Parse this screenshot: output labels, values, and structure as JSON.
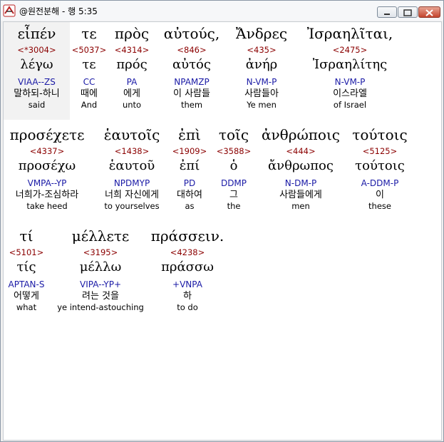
{
  "window": {
    "title": "@원전분해 - 행 5:35"
  },
  "rows": [
    [
      {
        "greek": "εἶπέν",
        "strong": "<*3004>",
        "lex": "λέγω",
        "morph": "VIAA--ZS",
        "korean": "말하되-하니",
        "english": "said"
      },
      {
        "greek": "τε",
        "strong": "<5037>",
        "lex": "τε",
        "morph": "CC",
        "korean": "때에",
        "english": "And"
      },
      {
        "greek": "πρὸς",
        "strong": "<4314>",
        "lex": "πρός",
        "morph": "PA",
        "korean": "에게",
        "english": "unto"
      },
      {
        "greek": "αὐτούς,",
        "strong": "<846>",
        "lex": "αὐτός",
        "morph": "NPAMZP",
        "korean": "이 사람들",
        "english": "them"
      },
      {
        "greek": "Ἄνδρες",
        "strong": "<435>",
        "lex": "ἀνήρ",
        "morph": "N-VM-P",
        "korean": "사람들아",
        "english": "Ye men"
      },
      {
        "greek": "Ἰσραηλῖται,",
        "strong": "<2475>",
        "lex": "Ἰσραηλίτης",
        "morph": "N-VM-P",
        "korean": "이스라엘",
        "english": "of Israel"
      }
    ],
    [
      {
        "greek": "προσέχετε",
        "strong": "<4337>",
        "lex": "προσέχω",
        "morph": "VMPA--YP",
        "korean": "너희가-조심하라",
        "english": "take heed"
      },
      {
        "greek": "ἑαυτοῖς",
        "strong": "<1438>",
        "lex": "ἑαυτοῦ",
        "morph": "NPDMYP",
        "korean": "너희 자신에게",
        "english": "to yourselves"
      },
      {
        "greek": "ἐπὶ",
        "strong": "<1909>",
        "lex": "ἐπί",
        "morph": "PD",
        "korean": "대하여",
        "english": "as"
      },
      {
        "greek": "τοῖς",
        "strong": "<3588>",
        "lex": "ὁ",
        "morph": "DDMP",
        "korean": "그",
        "english": "the"
      },
      {
        "greek": "ἀνθρώποις",
        "strong": "<444>",
        "lex": "ἄνθρωπος",
        "morph": "N-DM-P",
        "korean": "사람들에게",
        "english": "men"
      },
      {
        "greek": "τούτοις",
        "strong": "<5125>",
        "lex": "τούτοις",
        "morph": "A-DDM-P",
        "korean": "이",
        "english": "these"
      }
    ],
    [
      {
        "greek": "τί",
        "strong": "<5101>",
        "lex": "τίς",
        "morph": "APTAN-S",
        "korean": "어떻게",
        "english": "what"
      },
      {
        "greek": "μέλλετε",
        "strong": "<3195>",
        "lex": "μέλλω",
        "morph": "VIPA--YP+",
        "korean": "려는 것을",
        "english": "ye intend-astouching"
      },
      {
        "greek": "πράσσειν.",
        "strong": "<4238>",
        "lex": "πράσσω",
        "morph": "+VNPA",
        "korean": "하",
        "english": "to do"
      }
    ]
  ]
}
